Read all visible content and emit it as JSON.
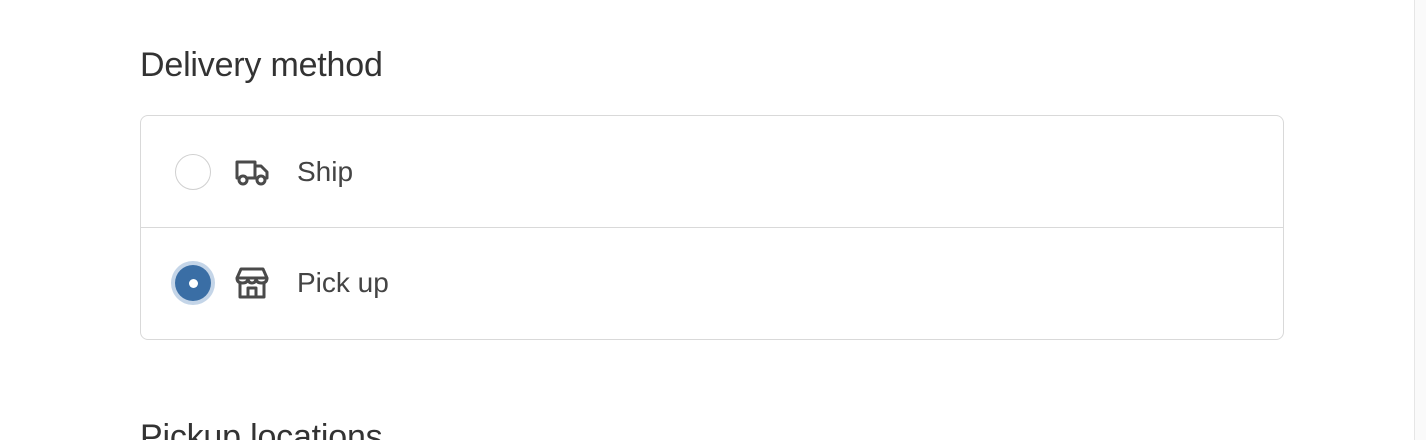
{
  "delivery": {
    "title": "Delivery method",
    "options": [
      {
        "label": "Ship",
        "icon": "truck-icon",
        "selected": false
      },
      {
        "label": "Pick up",
        "icon": "store-icon",
        "selected": true
      }
    ]
  },
  "pickup": {
    "title": "Pickup locations"
  },
  "colors": {
    "accent": "#3a6ea5",
    "accent_ring": "#c4d5e8",
    "border": "#d9d9d9",
    "text": "#333333"
  }
}
